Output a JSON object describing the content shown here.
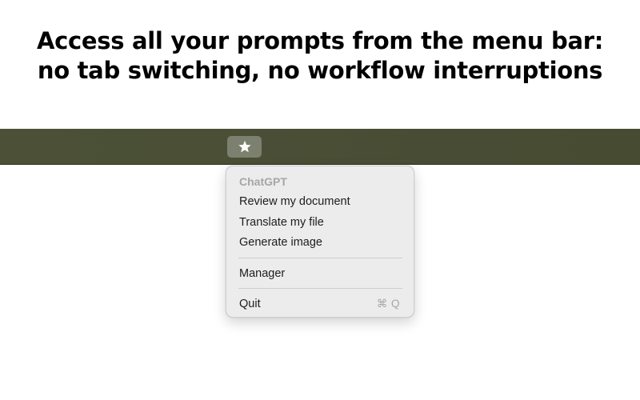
{
  "headline": {
    "line1": "Access all your prompts from the menu bar:",
    "line2": "no tab switching, no workflow interruptions"
  },
  "menubar": {
    "status_icon": "star-icon"
  },
  "menu": {
    "section_header": "ChatGPT",
    "items": [
      {
        "label": "Review my document"
      },
      {
        "label": "Translate my file"
      },
      {
        "label": "Generate image"
      }
    ],
    "manager_label": "Manager",
    "quit_label": "Quit",
    "quit_shortcut": "⌘ Q"
  }
}
